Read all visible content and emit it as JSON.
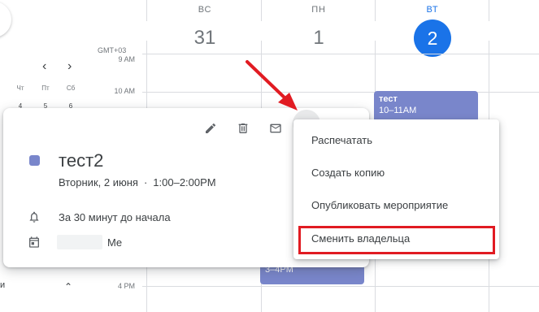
{
  "header": {
    "days": [
      {
        "abbr": "ВС",
        "num": "31",
        "today": false
      },
      {
        "abbr": "ПН",
        "num": "1",
        "today": false
      },
      {
        "abbr": "ВТ",
        "num": "2",
        "today": true
      }
    ],
    "timezone": "GMT+03"
  },
  "time_labels": {
    "t9": "9 AM",
    "t10": "10 AM",
    "t4": "4 PM"
  },
  "mini_calendar": {
    "weekdays": [
      "Чт",
      "Пт",
      "Сб"
    ],
    "dates": [
      "4",
      "5",
      "6"
    ]
  },
  "left_fragment": "и",
  "events": {
    "tuesday_event": {
      "title": "тест",
      "time": "10–11AM"
    },
    "monday_event": {
      "time": "3–4PM"
    }
  },
  "popup": {
    "title": "тест2",
    "date": "Вторник, 2 июня",
    "separator": "·",
    "time": "1:00–2:00PM",
    "reminder": "За 30 минут до начала",
    "owner_suffix": "Me",
    "icons": [
      "edit-icon",
      "delete-icon",
      "email-icon",
      "more-options-icon",
      "bell-icon",
      "calendar-icon"
    ]
  },
  "context_menu": {
    "items": [
      "Распечатать",
      "Создать копию",
      "Опубликовать мероприятие",
      "Сменить владельца"
    ]
  },
  "colors": {
    "event": "#7986cb",
    "today": "#1a73e8",
    "annotation": "#e11b22"
  }
}
